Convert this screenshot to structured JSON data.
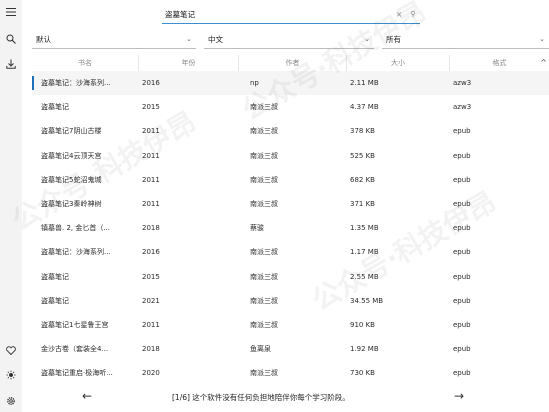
{
  "sidebar": {
    "icons": [
      "menu-icon",
      "search-icon",
      "download-icon",
      "heart-icon",
      "theme-icon",
      "settings-icon"
    ]
  },
  "search": {
    "value": "盗墓笔记",
    "clear": "×",
    "go": "⚲"
  },
  "filters": {
    "sort": "默认",
    "language": "中文",
    "format": "所有"
  },
  "table": {
    "headers": [
      "书名",
      "年份",
      "作者",
      "大小",
      "格式"
    ],
    "rows": [
      [
        "盗墓笔记：沙海系列...",
        "2016",
        "np",
        "2.11 MB",
        "azw3"
      ],
      [
        "盗墓笔记",
        "2015",
        "南派三叔",
        "4.37 MB",
        "azw3"
      ],
      [
        "盗墓笔记7阴山古楼",
        "2011",
        "南派三叔",
        "378 KB",
        "epub"
      ],
      [
        "盗墓笔记4云顶天宫",
        "2011",
        "南派三叔",
        "525 KB",
        "epub"
      ],
      [
        "盗墓笔记5蛇沼鬼城",
        "2011",
        "南派三叔",
        "682 KB",
        "epub"
      ],
      [
        "盗墓笔记3秦岭神树",
        "2011",
        "南派三叔",
        "371 KB",
        "epub"
      ],
      [
        "镇墓兽. 2, 金匕首（...",
        "2018",
        "蔡骏",
        "1.35 MB",
        "epub"
      ],
      [
        "盗墓笔记：沙海系列...",
        "2016",
        "南派三叔",
        "1.17 MB",
        "epub"
      ],
      [
        "盗墓笔记",
        "2015",
        "南派三叔",
        "2.55 MB",
        "epub"
      ],
      [
        "盗墓笔记",
        "2021",
        "南派三叔",
        "34.55 MB",
        "epub"
      ],
      [
        "盗墓笔记1七星鲁王宫",
        "2011",
        "南派三叔",
        "910 KB",
        "epub"
      ],
      [
        "金沙古卷（套装全4...",
        "2018",
        "鱼离泉",
        "1.92 MB",
        "epub"
      ],
      [
        "盗墓笔记重启·极海听...",
        "2020",
        "南派三叔",
        "730 KB",
        "epub"
      ]
    ]
  },
  "footer": {
    "prev": "←",
    "next": "→",
    "text": "[1/6] 这个软件没有任何负担地陪伴你每个学习阶段。"
  },
  "watermark": "公众号·科技伊昂"
}
